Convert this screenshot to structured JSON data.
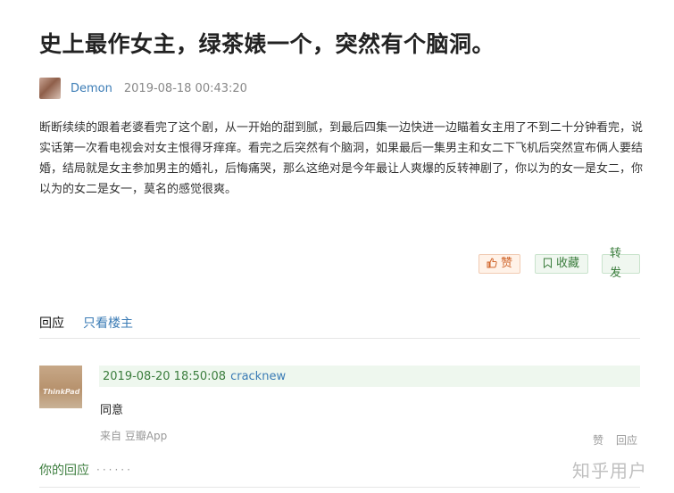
{
  "post": {
    "title": "史上最作女主，绿茶婊一个，突然有个脑洞。",
    "author": "Demon",
    "time": "2019-08-18 00:43:20",
    "content": "断断续续的跟着老婆看完了这个剧，从一开始的甜到腻，到最后四集一边快进一边瞄着女主用了不到二十分钟看完，说实话第一次看电视会对女主恨得牙痒痒。看完之后突然有个脑洞，如果最后一集男主和女二下飞机后突然宣布俩人要结婚，结局就是女主参加男主的婚礼，后悔痛哭，那么这绝对是今年最让人爽爆的反转神剧了，你以为的女一是女二，你以为的女二是女一，莫名的感觉很爽。"
  },
  "actions": {
    "like": "赞",
    "collect": "收藏",
    "share": "转发"
  },
  "tabs": {
    "reply": "回应",
    "owner_only": "只看楼主"
  },
  "comment": {
    "avatar_brand": "ThinkPad",
    "time": "2019-08-20 18:50:08",
    "user": "cracknew",
    "text": "同意",
    "source": "来自 豆瓣App",
    "like": "赞",
    "reply": "回应"
  },
  "your_reply": {
    "label": "你的回应",
    "dots": "······"
  },
  "watermark": "知乎用户"
}
